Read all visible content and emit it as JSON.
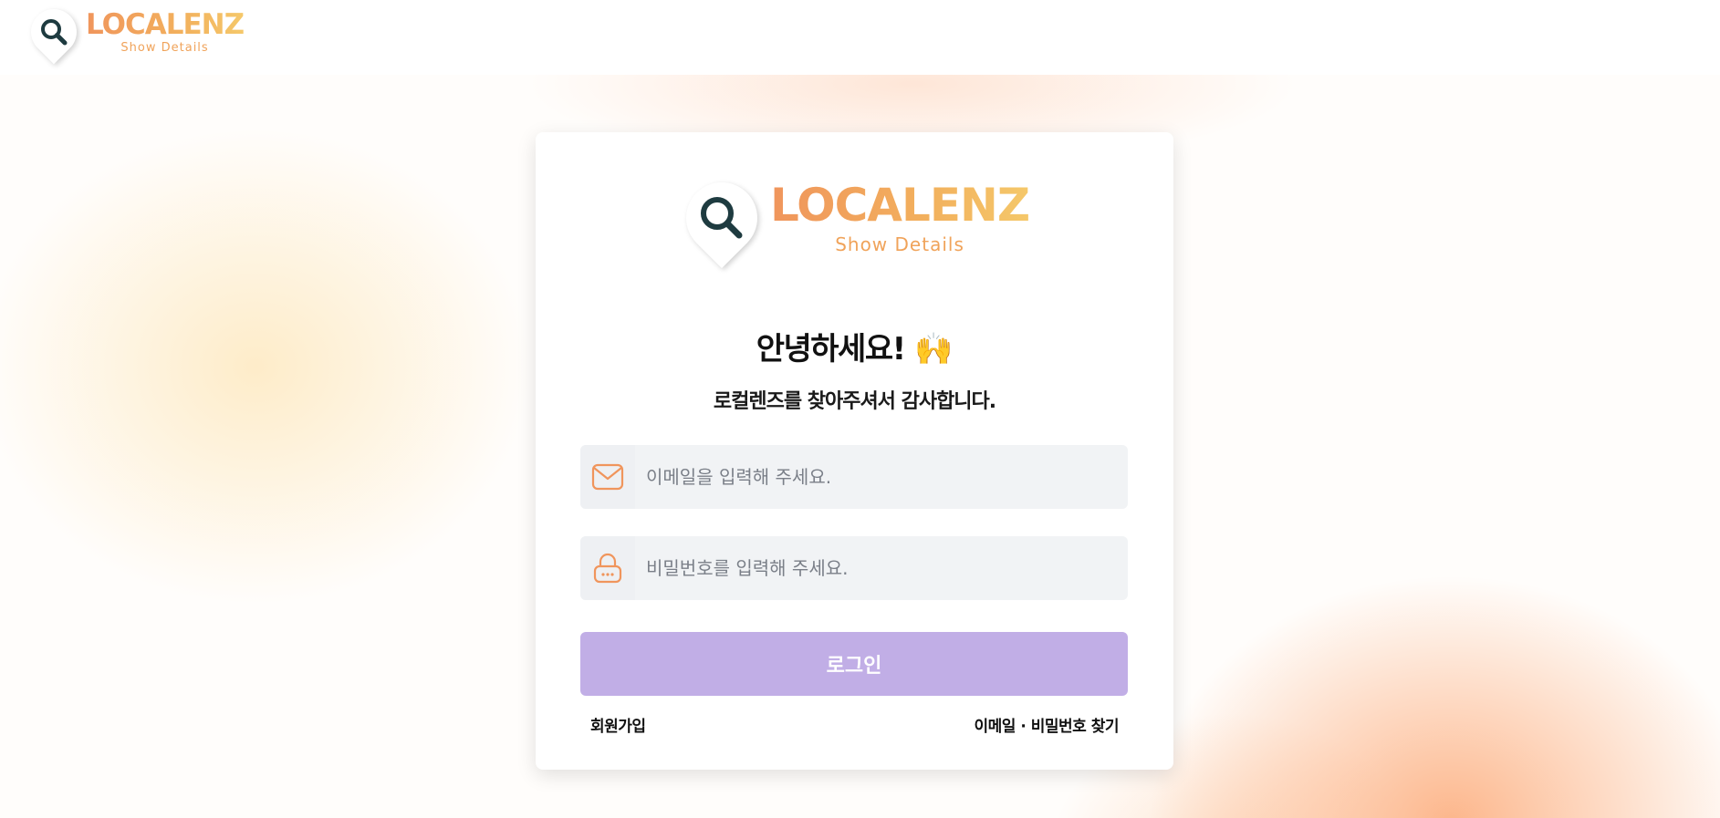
{
  "header": {
    "logo": {
      "wordmark": "LOCALENZ",
      "tagline": "Show Details",
      "icon": "search-pin-icon"
    }
  },
  "card": {
    "logo": {
      "wordmark": "LOCALENZ",
      "tagline": "Show Details",
      "icon": "search-pin-icon"
    },
    "greeting": "안녕하세요!",
    "greeting_emoji": "🙌",
    "subtitle": "로컬렌즈를 찾아주셔서 감사합니다.",
    "email_field": {
      "icon": "mail-icon",
      "value": "",
      "placeholder": "이메일을 입력해 주세요."
    },
    "password_field": {
      "icon": "lock-icon",
      "value": "",
      "placeholder": "비밀번호를 입력해 주세요."
    },
    "login_button": "로그인",
    "signup_link": "회원가입",
    "find_link": "이메일 · 비밀번호 찾기"
  },
  "colors": {
    "accent_orange": "#f0955c",
    "logo_gold": "#f5c86a",
    "login_button_bg": "#c1aee6",
    "input_bg": "#f1f3f5",
    "icon_dark": "#1e3b40"
  }
}
